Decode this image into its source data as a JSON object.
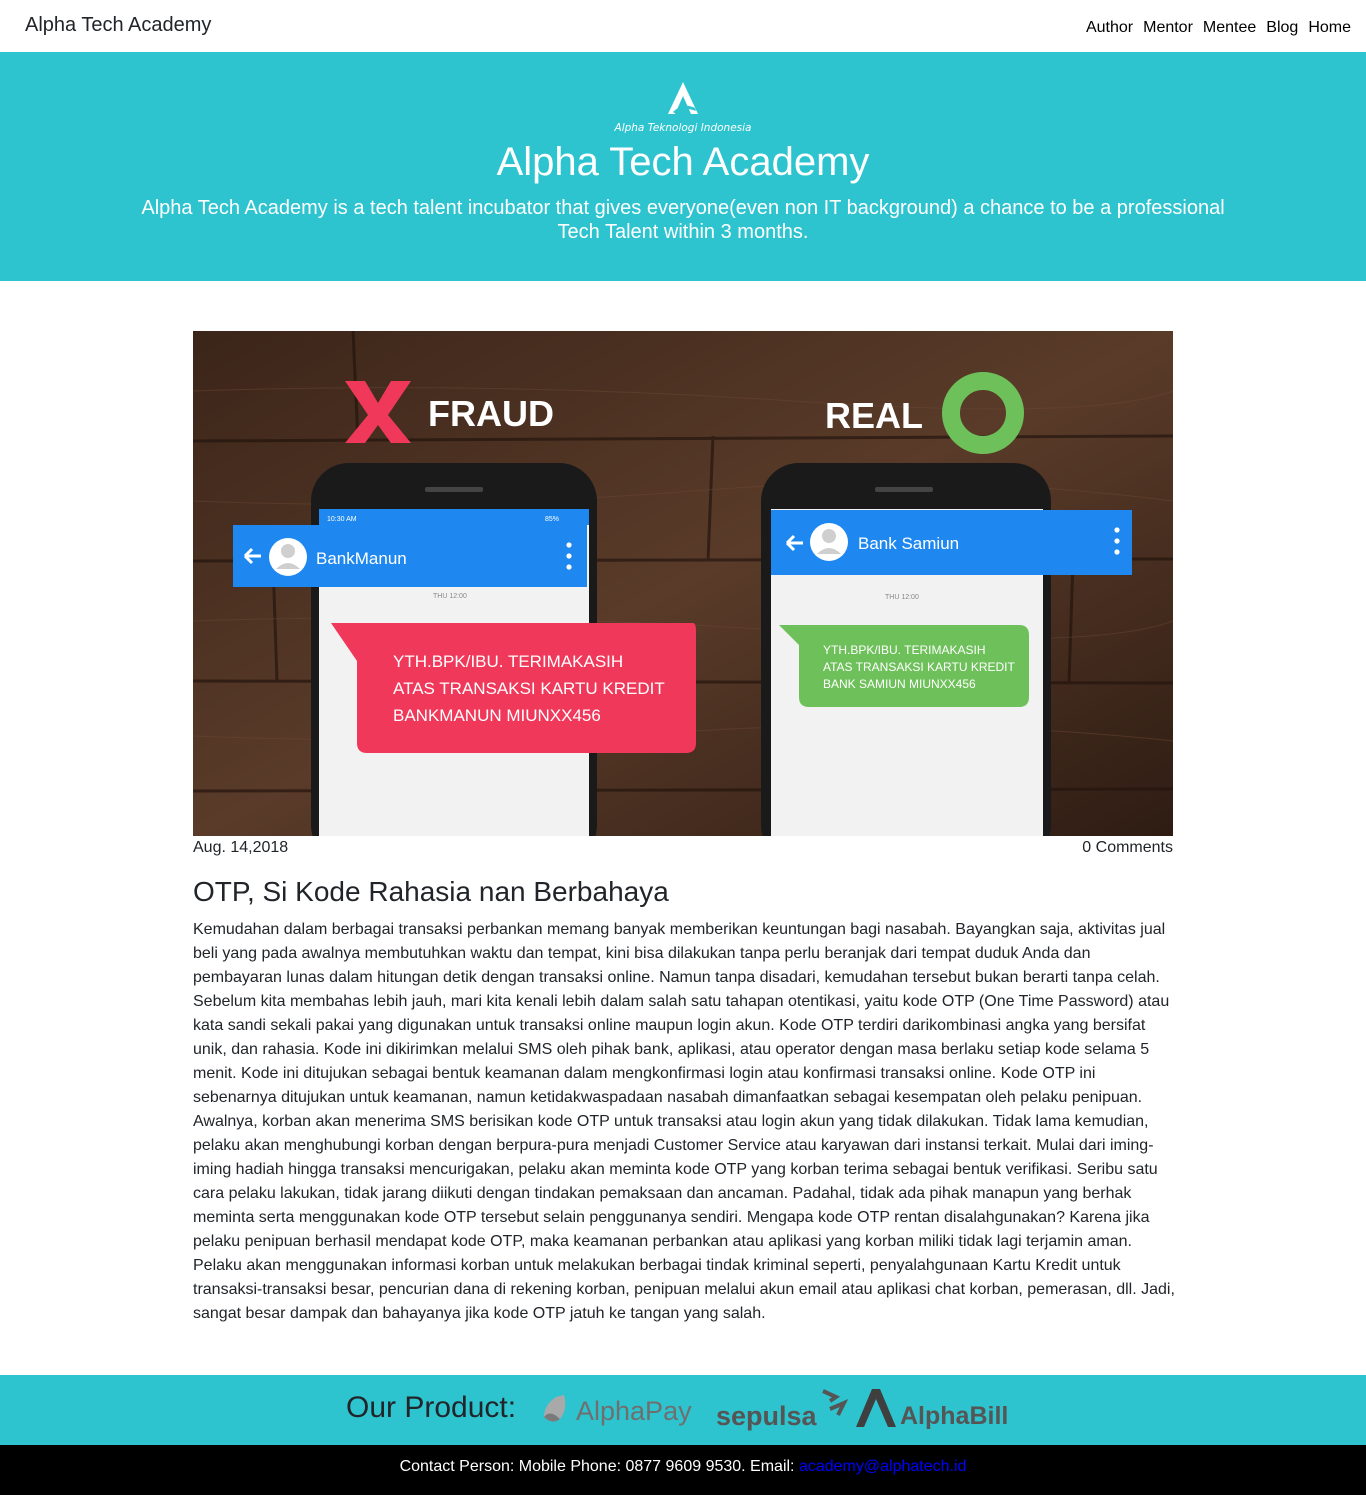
{
  "navbar": {
    "brand": "Alpha Tech Academy",
    "links": [
      "Author",
      "Mentor",
      "Mentee",
      "Blog",
      "Home"
    ]
  },
  "hero": {
    "logo_text": "Alpha Teknologi Indonesia",
    "title": "Alpha Tech Academy",
    "description": "Alpha Tech Academy is a tech talent incubator that gives everyone(even non IT background) a chance to be a professional Tech Talent within 3 months."
  },
  "article": {
    "image": {
      "fraud_label": "FRAUD",
      "real_label": "REAL",
      "fraud_sender": "BankManun",
      "real_sender": "Bank Samiun",
      "status_time": "10:30 AM",
      "battery": "85%",
      "thread_date": "THU 12:00",
      "fraud_message": [
        "YTH.BPK/IBU. TERIMAKASIH",
        "ATAS TRANSAKSI KARTU KREDIT",
        "BANKMANUN MIUNXX456"
      ],
      "real_message": [
        "YTH.BPK/IBU. TERIMAKASIH",
        "ATAS TRANSAKSI KARTU KREDIT",
        "BANK SAMIUN MIUNXX456"
      ]
    },
    "date": "Aug. 14,2018",
    "comments": "0 Comments",
    "title": "OTP, Si Kode Rahasia nan Berbahaya",
    "body": "Kemudahan dalam berbagai transaksi perbankan memang banyak memberikan keuntungan bagi nasabah. Bayangkan saja, aktivitas jual beli yang pada awalnya membutuhkan waktu dan tempat, kini bisa dilakukan tanpa perlu beranjak dari tempat duduk Anda dan pembayaran lunas dalam hitungan detik dengan transaksi online. Namun tanpa disadari, kemudahan tersebut bukan berarti tanpa celah. Sebelum kita membahas lebih jauh, mari kita kenali lebih dalam salah satu tahapan otentikasi, yaitu kode OTP (One Time Password) atau kata sandi sekali pakai yang digunakan untuk transaksi online maupun login akun. Kode OTP terdiri darikombinasi angka yang bersifat unik, dan rahasia. Kode ini dikirimkan melalui SMS oleh pihak bank, aplikasi, atau operator dengan masa berlaku setiap kode selama 5 menit. Kode ini ditujukan sebagai bentuk keamanan dalam mengkonfirmasi login atau konfirmasi transaksi online. Kode OTP ini sebenarnya ditujukan untuk keamanan, namun ketidakwaspadaan nasabah dimanfaatkan sebagai kesempatan oleh pelaku penipuan. Awalnya, korban akan menerima SMS berisikan kode OTP untuk transaksi atau login akun yang tidak dilakukan. Tidak lama kemudian, pelaku akan menghubungi korban dengan berpura-pura menjadi Customer Service atau karyawan dari instansi terkait. Mulai dari iming-iming hadiah hingga transaksi mencurigakan, pelaku akan meminta kode OTP yang korban terima sebagai bentuk verifikasi. Seribu satu cara pelaku lakukan, tidak jarang diikuti dengan tindakan pemaksaan dan ancaman. Padahal, tidak ada pihak manapun yang berhak meminta serta menggunakan kode OTP tersebut selain penggunanya sendiri. Mengapa kode OTP rentan disalahgunakan? Karena jika pelaku penipuan berhasil mendapat kode OTP, maka keamanan perbankan atau aplikasi yang korban miliki tidak lagi terjamin aman. Pelaku akan menggunakan informasi korban untuk melakukan berbagai tindak kriminal seperti, penyalahgunaan Kartu Kredit untuk transaksi-transaksi besar, pencurian dana di rekening korban, penipuan melalui akun email atau aplikasi chat korban, pemerasan, dll. Jadi, sangat besar dampak dan bahayanya jika kode OTP jatuh ke tangan yang salah."
  },
  "products": {
    "label": "Our Product:",
    "items": [
      "AlphaPay",
      "sepulsa",
      "AlphaBill"
    ]
  },
  "footer": {
    "contact_text": "Contact Person: Mobile Phone: 0877 9609 9530. Email: ",
    "email": "academy@alphatech.id"
  },
  "colors": {
    "accent": "#2ec4cf",
    "fraud_red": "#f0385a",
    "real_green": "#6ec05a",
    "chat_header_blue": "#1e88f0"
  }
}
